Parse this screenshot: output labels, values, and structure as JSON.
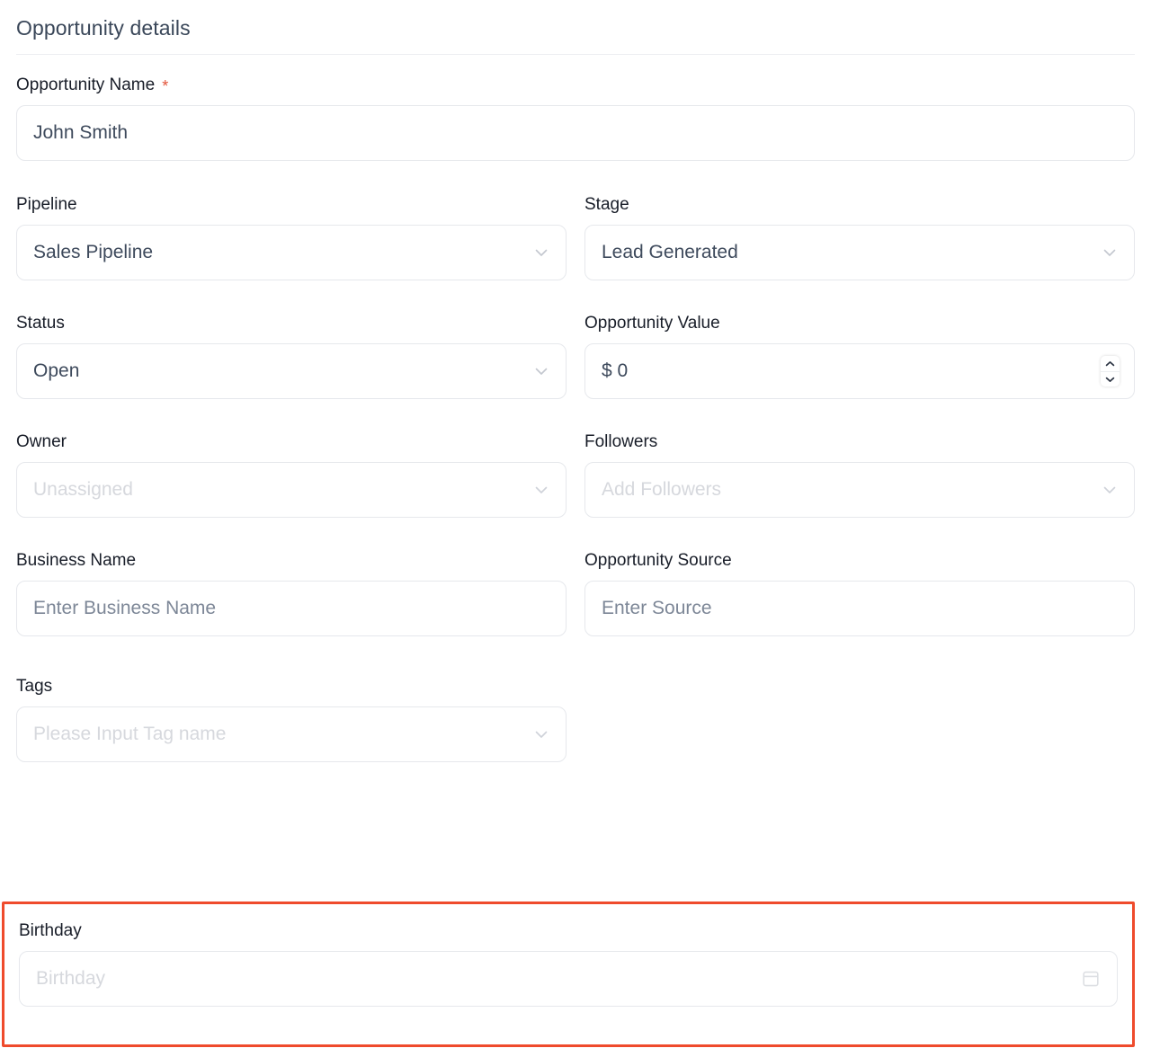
{
  "section": {
    "title": "Opportunity details"
  },
  "colors": {
    "accent_highlight": "#ef4b2c",
    "required_star": "#e2543a",
    "border": "#e6e8ec",
    "label": "#181d28",
    "value_text": "#3e4a5c",
    "placeholder_light": "#d6d8dd",
    "placeholder_slate": "#7d8797",
    "heading": "#3a4759"
  },
  "fields": {
    "opportunity_name": {
      "label": "Opportunity Name",
      "required_marker": "*",
      "value": "John Smith"
    },
    "pipeline": {
      "label": "Pipeline",
      "value": "Sales Pipeline",
      "icon": "chevron-down-icon"
    },
    "stage": {
      "label": "Stage",
      "value": "Lead Generated",
      "icon": "chevron-down-icon"
    },
    "status": {
      "label": "Status",
      "value": "Open",
      "icon": "chevron-down-icon"
    },
    "opportunity_value": {
      "label": "Opportunity Value",
      "value": "$ 0",
      "icon": "number-stepper-icon"
    },
    "owner": {
      "label": "Owner",
      "placeholder": "Unassigned",
      "icon": "chevron-down-icon"
    },
    "followers": {
      "label": "Followers",
      "placeholder": "Add Followers",
      "icon": "chevron-down-icon"
    },
    "business_name": {
      "label": "Business Name",
      "placeholder": "Enter Business Name"
    },
    "opportunity_source": {
      "label": "Opportunity Source",
      "placeholder": "Enter Source"
    },
    "tags": {
      "label": "Tags",
      "placeholder": "Please Input Tag name",
      "icon": "chevron-down-icon"
    },
    "birthday": {
      "label": "Birthday",
      "placeholder": "Birthday",
      "icon": "calendar-icon"
    }
  }
}
